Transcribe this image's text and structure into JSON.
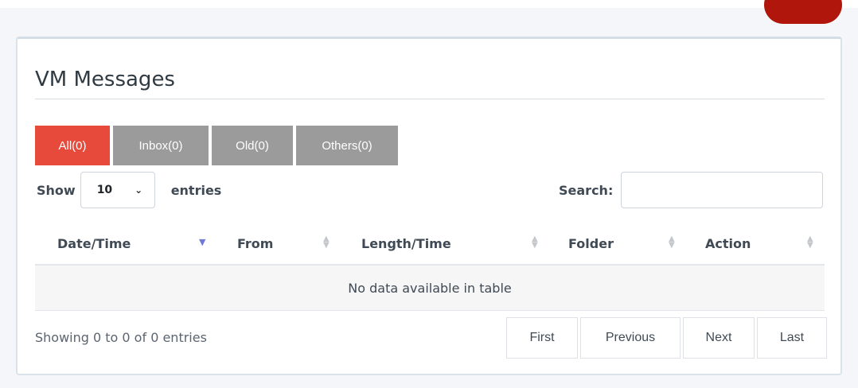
{
  "card": {
    "title": "VM Messages"
  },
  "tabs": [
    {
      "label": "All(0)"
    },
    {
      "label": "Inbox(0)"
    },
    {
      "label": "Old(0)"
    },
    {
      "label": "Others(0)"
    }
  ],
  "length": {
    "show_label": "Show",
    "selected": "10",
    "entries_label": "entries"
  },
  "search": {
    "label": "Search:",
    "value": ""
  },
  "table": {
    "columns": [
      "Date/Time",
      "From",
      "Length/Time",
      "Folder",
      "Action"
    ],
    "empty_message": "No data available in table"
  },
  "info": "Showing 0 to 0 of 0 entries",
  "pagination": {
    "first": "First",
    "previous": "Previous",
    "next": "Next",
    "last": "Last"
  },
  "colors": {
    "active_tab": "#e74a3b",
    "inactive_tab": "#9b9b9b",
    "top_button": "#b0160c"
  }
}
